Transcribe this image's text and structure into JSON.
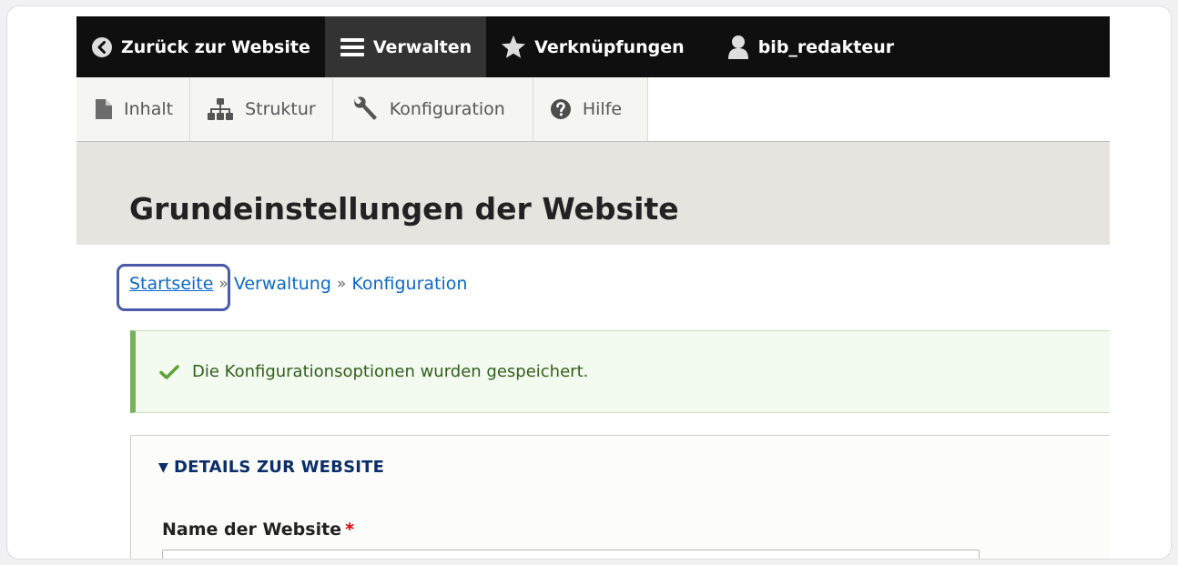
{
  "toolbar": {
    "back": "Zurück zur Website",
    "manage": "Verwalten",
    "shortcuts": "Verknüpfungen",
    "user": "bib_redakteur"
  },
  "tray": {
    "content": "Inhalt",
    "structure": "Struktur",
    "configuration": "Konfiguration",
    "help": "Hilfe"
  },
  "page": {
    "title": "Grundeinstellungen der Website"
  },
  "breadcrumb": {
    "items": [
      "Startseite",
      "Verwaltung",
      "Konfiguration"
    ],
    "separator": "»"
  },
  "status": {
    "message": "Die Konfigurationsoptionen wurden gespeichert.",
    "color": "#77b259"
  },
  "details": {
    "summary": "DETAILS ZUR WEBSITE",
    "site_name_label": "Name der Website",
    "required_marker": "*",
    "site_name_value": ""
  },
  "colors": {
    "toolbar_bg": "#0f0f0f",
    "link": "#0b69c8",
    "focus": "#4a5aa8"
  }
}
